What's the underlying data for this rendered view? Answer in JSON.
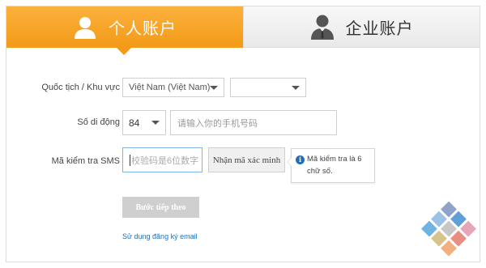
{
  "tabs": {
    "personal": {
      "label": "个人账户",
      "icon": "person-icon",
      "active": true
    },
    "business": {
      "label": "企业账户",
      "icon": "businessman-icon",
      "active": false
    }
  },
  "form": {
    "nationality": {
      "label": "Quốc tịch / Khu vực",
      "country_value": "Việt Nam (Việt Nam)",
      "region_value": ""
    },
    "phone": {
      "label": "Số di động",
      "code_value": "84",
      "placeholder": "请输入你的手机号码"
    },
    "sms": {
      "label": "Mã kiểm tra SMS",
      "placeholder": "校验码是6位数字",
      "get_code_button": "Nhận mã xác minh",
      "tooltip_line1": "Mã kiểm tra là 6",
      "tooltip_line2": "chữ số."
    },
    "next_button": "Bước tiếp theo",
    "email_link": "Sử dụng đăng ký email"
  },
  "colors": {
    "accent": "#f39a18",
    "link": "#1f6fb8",
    "disabled_button": "#cfcfcf"
  }
}
